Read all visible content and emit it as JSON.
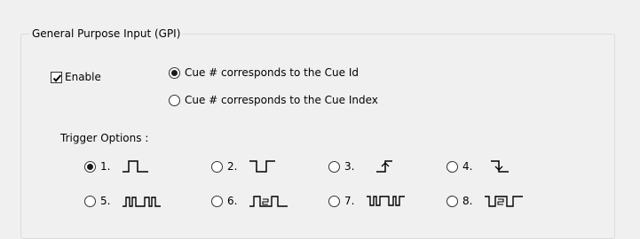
{
  "group": {
    "title": "General Purpose Input (GPI)"
  },
  "enable": {
    "label": "Enable",
    "checked": true
  },
  "cue_mode": {
    "options": [
      {
        "label": "Cue # corresponds to the Cue Id",
        "selected": true
      },
      {
        "label": "Cue # corresponds to the Cue Index",
        "selected": false
      }
    ]
  },
  "trigger": {
    "title": "Trigger Options :",
    "options": [
      {
        "label": "1.",
        "icon": "single-positive-pulse-icon",
        "selected": true
      },
      {
        "label": "2.",
        "icon": "single-negative-pulse-icon",
        "selected": false
      },
      {
        "label": "3.",
        "icon": "rising-edge-icon",
        "selected": false
      },
      {
        "label": "4.",
        "icon": "falling-edge-icon",
        "selected": false
      },
      {
        "label": "5.",
        "icon": "pulse-train-positive-icon",
        "selected": false
      },
      {
        "label": "6.",
        "icon": "double-pulse-positive-icon",
        "selected": false
      },
      {
        "label": "7.",
        "icon": "pulse-train-negative-icon",
        "selected": false
      },
      {
        "label": "8.",
        "icon": "double-pulse-negative-icon",
        "selected": false
      }
    ]
  }
}
